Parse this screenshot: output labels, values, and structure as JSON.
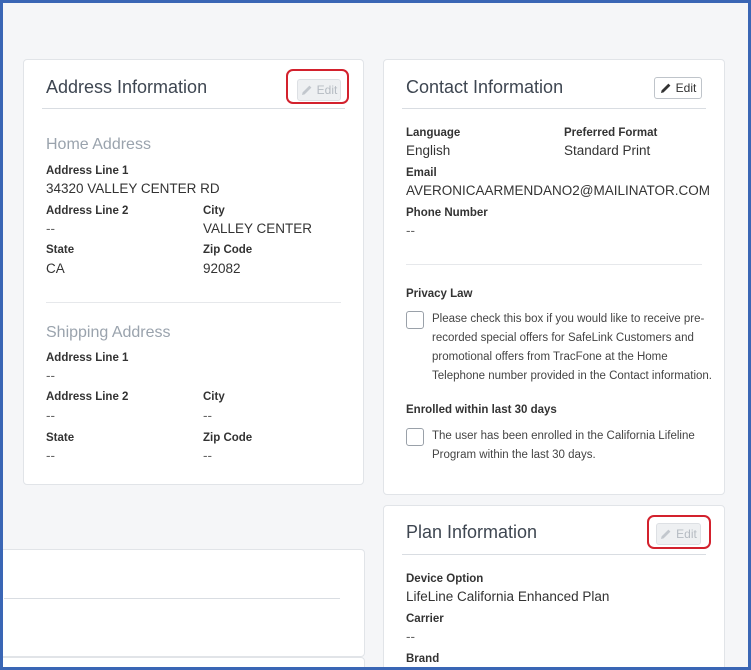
{
  "address_card": {
    "title": "Address Information",
    "edit_label": "Edit",
    "home": {
      "heading": "Home Address",
      "line1_label": "Address Line 1",
      "line1_value": "34320 VALLEY CENTER RD",
      "line2_label": "Address Line 2",
      "line2_value": "--",
      "city_label": "City",
      "city_value": "VALLEY CENTER",
      "state_label": "State",
      "state_value": "CA",
      "zip_label": "Zip Code",
      "zip_value": "92082"
    },
    "shipping": {
      "heading": "Shipping Address",
      "line1_label": "Address Line 1",
      "line1_value": "--",
      "line2_label": "Address Line 2",
      "line2_value": "--",
      "city_label": "City",
      "city_value": "--",
      "state_label": "State",
      "state_value": "--",
      "zip_label": "Zip Code",
      "zip_value": "--"
    }
  },
  "contact_card": {
    "title": "Contact Information",
    "edit_label": "Edit",
    "language_label": "Language",
    "language_value": "English",
    "format_label": "Preferred Format",
    "format_value": "Standard Print",
    "email_label": "Email",
    "email_value": "AVERONICAARMENDANO2@MAILINATOR.COM",
    "phone_label": "Phone Number",
    "phone_value": "--",
    "privacy_label": "Privacy Law",
    "privacy_lines": [
      "Please check this box if you would like to receive pre-",
      "recorded special offers for SafeLink Customers and",
      "promotional offers from TracFone at the Home",
      "Telephone number provided in the Contact information."
    ],
    "enrolled_label": "Enrolled within last 30 days",
    "enrolled_lines": [
      "The user has been enrolled in the California Lifeline",
      "Program within the last 30 days."
    ]
  },
  "plan_card": {
    "title": "Plan Information",
    "edit_label": "Edit",
    "device_label": "Device Option",
    "device_value": "LifeLine California Enhanced Plan",
    "carrier_label": "Carrier",
    "carrier_value": "--",
    "brand_label": "Brand"
  },
  "colors": {
    "frame_border": "#3a66b5",
    "highlight": "#d3212d"
  }
}
